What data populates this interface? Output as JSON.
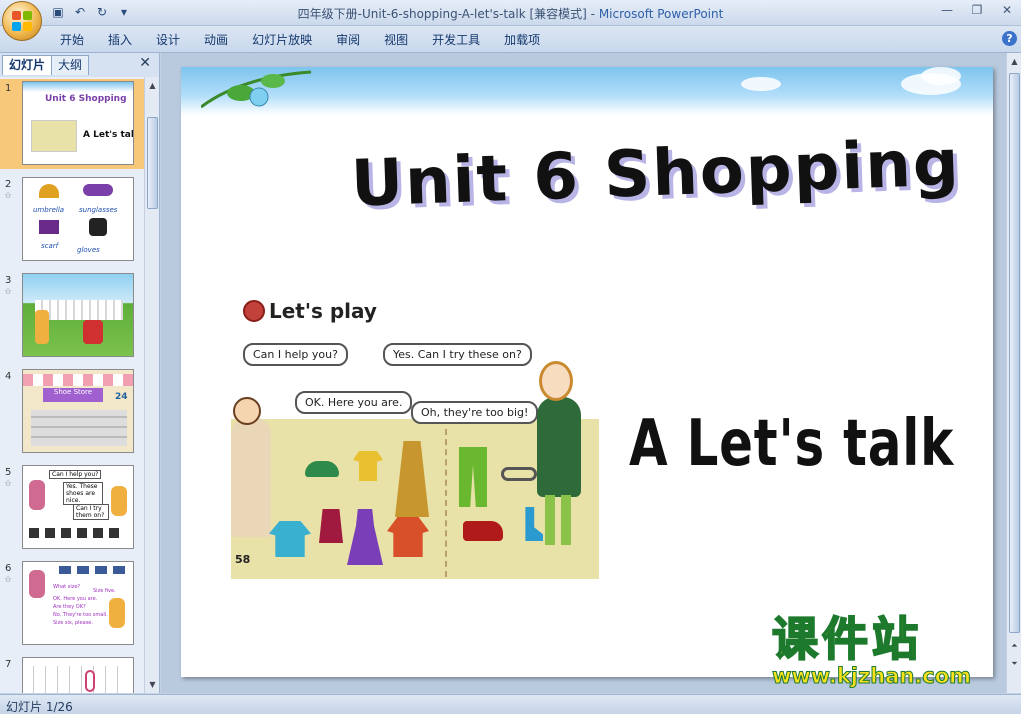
{
  "window": {
    "title": "四年级下册-Unit-6-shopping-A-let's-talk [兼容模式] - ",
    "app_name": "Microsoft PowerPoint"
  },
  "qat": {
    "save_icon": "save-icon",
    "undo_icon": "undo-icon",
    "redo_icon": "redo-icon",
    "customize_icon": "chevron-down-icon"
  },
  "ribbon": {
    "tabs": [
      "开始",
      "插入",
      "设计",
      "动画",
      "幻灯片放映",
      "审阅",
      "视图",
      "开发工具",
      "加载项"
    ]
  },
  "left_pane": {
    "tabs": [
      "幻灯片",
      "大纲"
    ],
    "close_glyph": "✕",
    "slides": [
      {
        "num": "1",
        "selected": true,
        "title": "Unit 6 Shopping",
        "caption": "A Let's talk"
      },
      {
        "num": "2",
        "selected": false,
        "words": [
          "umbrella",
          "sunglasses",
          "scarf",
          "gloves"
        ]
      },
      {
        "num": "3",
        "selected": false
      },
      {
        "num": "4",
        "selected": false,
        "number_tag": "24"
      },
      {
        "num": "5",
        "selected": false,
        "bubbles": [
          "Can I help you?",
          "Yes. These shoes are nice.",
          "Can I try them on?"
        ]
      },
      {
        "num": "6",
        "selected": false,
        "lines": [
          "What size?",
          "Size five.",
          "OK. Here you are.",
          "Are they OK?",
          "No. They're too small.",
          "Size six, please."
        ]
      },
      {
        "num": "7",
        "selected": false
      }
    ]
  },
  "slide": {
    "title": "Unit 6 Shopping",
    "subtitle": "A Let's talk",
    "scene": {
      "heading": "Let's play",
      "bubbles": [
        "Can I help you?",
        "Yes. Can I try these on?",
        "OK. Here you are.",
        "Oh, they're too big!"
      ],
      "page_number": "58"
    }
  },
  "watermark": {
    "cn": "课件站",
    "url": "www.kjzhan.com"
  },
  "status": {
    "slide_info": "幻灯片 1/26"
  },
  "colors": {
    "accent": "#2f5fa8",
    "selected_thumb": "#f8c87a",
    "watermark_fill": "#f7e21b",
    "watermark_stroke": "#1d7a2d"
  }
}
